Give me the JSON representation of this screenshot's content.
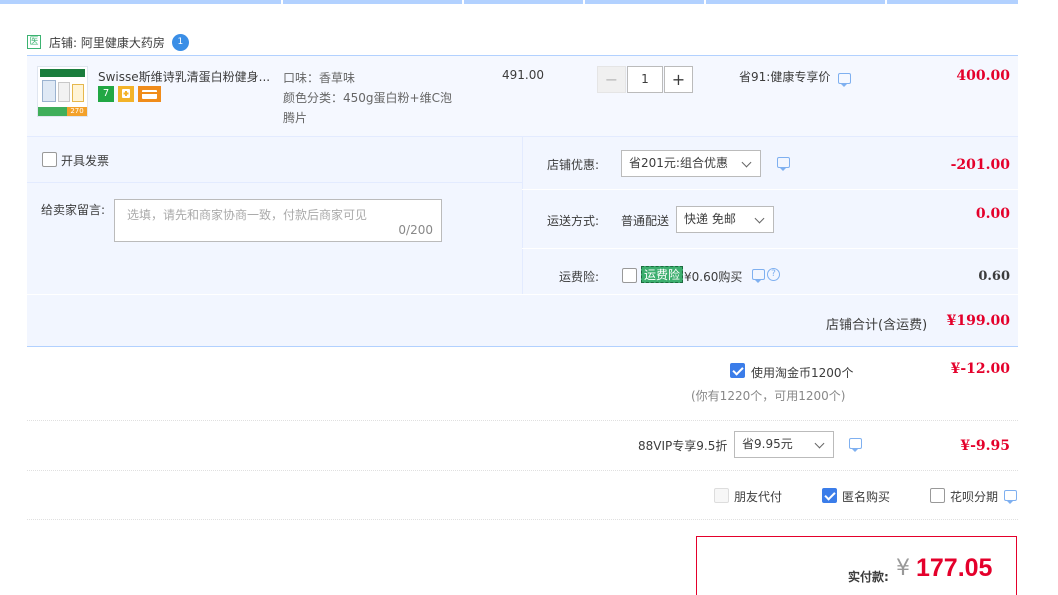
{
  "shop": {
    "badge": "医",
    "label": "店铺: 阿里健康大药房",
    "wangwang_badge": "1"
  },
  "item": {
    "thumb_badge": "270",
    "title": "Swisse斯维诗乳清蛋白粉健身...",
    "tag1": "7",
    "sku_flavor": "口味：香草味",
    "sku_color": "颜色分类：450g蛋白粉+维C泡腾片",
    "unit_price": "491.00",
    "quantity": "1",
    "qty_minus": "−",
    "qty_plus": "+",
    "promo": "省91:健康专享价",
    "total": "400.00"
  },
  "invoice": {
    "label": "开具发票",
    "checked": false
  },
  "message": {
    "label": "给卖家留言:",
    "placeholder": "选填，请先和商家协商一致，付款后商家可见",
    "counter": "0/200"
  },
  "shop_discount": {
    "label": "店铺优惠:",
    "selected": "省201元:组合优惠",
    "amount": "-201.00"
  },
  "shipping": {
    "label": "运送方式:",
    "method": "普通配送",
    "selected": "快递 免邮",
    "amount": "0.00"
  },
  "insurance": {
    "label": "运费险:",
    "tag": "运费险",
    "text": "¥0.60购买",
    "amount": "0.60",
    "checked": false
  },
  "shop_total": {
    "label": "店铺合计(含运费)",
    "amount": "¥199.00"
  },
  "coins": {
    "label": "使用淘金币1200个",
    "sub": "(你有1220个，可用1200个)",
    "amount": "¥-12.00",
    "checked": true
  },
  "vip": {
    "label": "88VIP专享9.5折",
    "selected": "省9.95元",
    "amount": "¥-9.95"
  },
  "options": {
    "friend_pay": "朋友代付",
    "anonymous": "匿名购买",
    "huabei": "花呗分期",
    "anonymous_checked": true
  },
  "payment": {
    "label": "实付款:",
    "currency": "¥",
    "amount": "177.05"
  },
  "colors": {
    "accent_blue": "#3b7de9",
    "price_red": "#e4002b",
    "panel_bg": "#f2f6ff"
  }
}
